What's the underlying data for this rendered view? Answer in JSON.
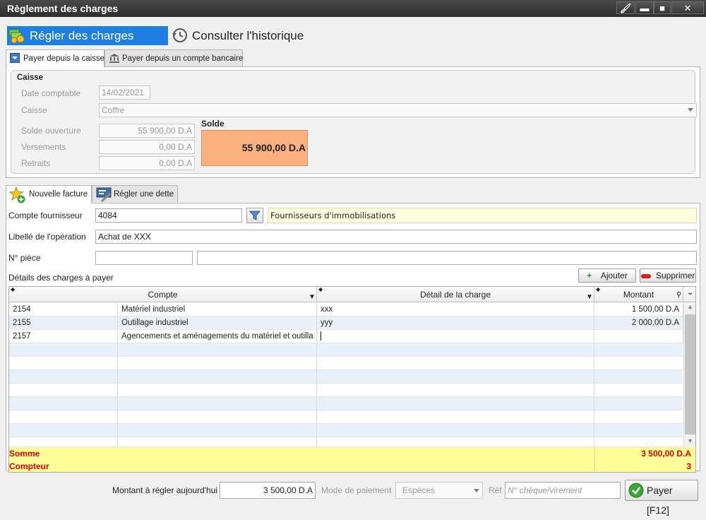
{
  "window": {
    "title": "Règlement des charges",
    "controls": {
      "pin": "🖌",
      "minimize": "▬",
      "maximize": "■",
      "close": "✕"
    }
  },
  "nav": {
    "active_tab": "Régler des charges",
    "history_tab": "Consulter l'historique"
  },
  "source_tabs": [
    {
      "label": "Payer depuis la caisse",
      "icon": "cash-drawer-icon"
    },
    {
      "label": "Payer depuis un compte bancaire",
      "icon": "bank-icon"
    }
  ],
  "caisse": {
    "group_label": "Caisse",
    "date_label": "Date comptable",
    "date_value": "14/02/2021",
    "caisse_label": "Caisse",
    "caisse_value": "Coffre",
    "solde_ouverture_label": "Solde ouverture",
    "solde_ouverture_value": "55 900,00 D.A",
    "versements_label": "Versements",
    "versements_value": "0,00 D.A",
    "retraits_label": "Retraits",
    "retraits_value": "0,00 D.A",
    "solde_label": "Solde",
    "solde_value": "55 900,00 D.A"
  },
  "invoice_tabs": [
    {
      "label": "Nouvelle facture",
      "icon": "star-add-icon"
    },
    {
      "label": "Régler une dette",
      "icon": "debt-icon"
    }
  ],
  "invoice": {
    "compte_label": "Compte fournisseur",
    "compte_value": "4084",
    "compte_name": "Fournisseurs d'immobilisations",
    "libelle_label": "Libellé de l'opération",
    "libelle_value": "Achat de XXX",
    "piece_label": "N° pièce",
    "piece_value": "",
    "piece_extra": ""
  },
  "details": {
    "title": "Détails des charges à payer",
    "add_button": "Ajouter",
    "delete_button": "Supprimer",
    "columns": [
      "Compte",
      "Détail de la charge",
      "Montant"
    ],
    "rows": [
      {
        "code": "2154",
        "compte": "Matériel industriel",
        "detail": "xxx",
        "montant": "1 500,00 D.A"
      },
      {
        "code": "2155",
        "compte": "Outillage industriel",
        "detail": "yyy",
        "montant": "2 000,00 D.A"
      },
      {
        "code": "2157",
        "compte": "Agencements et aménagements du matériel et outilla",
        "detail": "",
        "montant": ""
      }
    ],
    "somme_label": "Somme",
    "somme_value": "3 500,00 D.A",
    "compteur_label": "Compteur",
    "compteur_value": "3"
  },
  "payment": {
    "amount_label": "Montant à régler aujourd'hui",
    "amount_value": "3 500,00 D.A",
    "mode_label": "Mode de paiement",
    "mode_value": "Espèces",
    "ref_label": "Réf",
    "ref_placeholder": "N° chèque/virement",
    "pay_button": "Payer [F12]"
  },
  "colors": {
    "accent": "#1f7fe0",
    "solde_bg": "#fbb080",
    "footer_bg": "#ffff99",
    "footer_text": "#e00000",
    "lookup_bg": "#ffffe0"
  }
}
